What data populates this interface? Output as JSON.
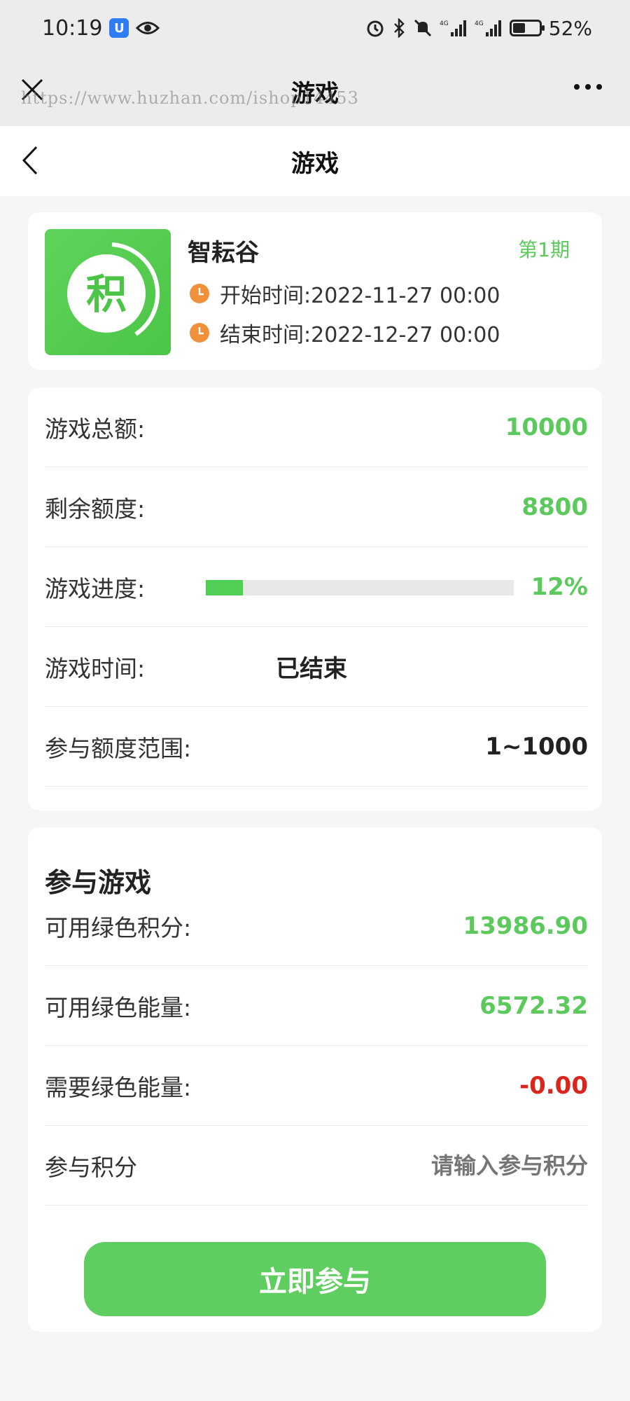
{
  "status_bar": {
    "time": "10:19",
    "battery": "52%",
    "battery_level": 0.52
  },
  "webview": {
    "title": "游戏",
    "url_watermark": "https://www.huzhan.com/ishop14453"
  },
  "header": {
    "title": "游戏"
  },
  "game": {
    "name": "智耘谷",
    "period": "第1期",
    "logo_char": "积",
    "start_time": "开始时间:2022-11-27 00:00",
    "end_time": "结束时间:2022-12-27 00:00"
  },
  "stats": {
    "total_label": "游戏总额:",
    "total_value": "10000",
    "remaining_label": "剩余额度:",
    "remaining_value": "8800",
    "progress_label": "游戏进度:",
    "progress_value": "12%",
    "progress_fraction": 0.12,
    "time_label": "游戏时间:",
    "time_value": "已结束",
    "range_label": "参与额度范围:",
    "range_value": "1~1000"
  },
  "join": {
    "section_title": "参与游戏",
    "points_label": "可用绿色积分:",
    "points_value": "13986.90",
    "energy_label": "可用绿色能量:",
    "energy_value": "6572.32",
    "need_label": "需要绿色能量:",
    "need_value": "-0.00",
    "input_label": "参与积分",
    "input_placeholder": "请输入参与积分",
    "button_label": "立即参与"
  },
  "colors": {
    "accent": "#5bc95b",
    "negative": "#d9261c",
    "clock": "#f0903a"
  },
  "icons": [
    "close-icon",
    "more-icon",
    "back-icon",
    "clock-icon",
    "alarm-icon",
    "bluetooth-icon",
    "mute-icon",
    "signal-icon",
    "battery-icon",
    "eye-icon"
  ]
}
